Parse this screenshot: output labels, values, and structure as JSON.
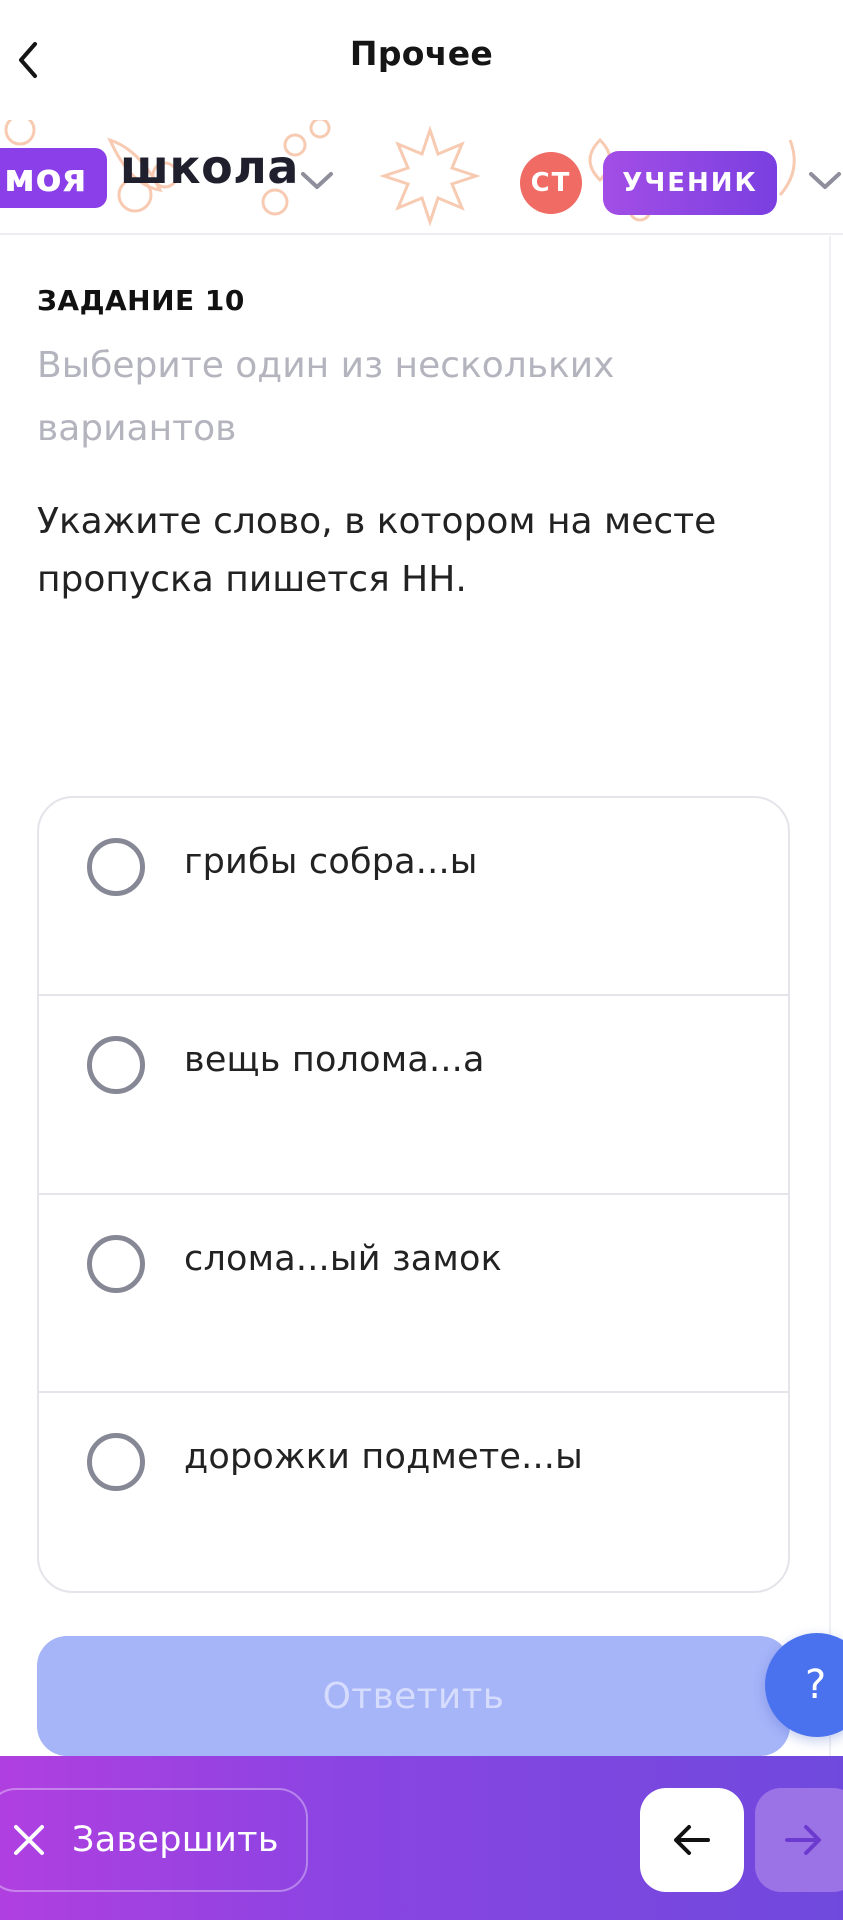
{
  "nav": {
    "title": "Прочее",
    "back_icon": "chevron-left-icon"
  },
  "brand": {
    "badge": "моя",
    "word": "школа",
    "accent_color": "#8a3fe8"
  },
  "user": {
    "initials": "СТ",
    "role": "УЧЕНИК",
    "avatar_color": "#ef6b64"
  },
  "task": {
    "label": "ЗАДАНИЕ 10",
    "instruction": "Выберите один из нескольких вариантов",
    "question": "Укажите слово, в котором на месте пропуска пишется НН.",
    "options": [
      "грибы собра...ы",
      "вещь полома...а",
      "слома...ый замок",
      "дорожки подмете...ы"
    ],
    "submit_label": "Ответить",
    "submit_color": "#a6b4f8"
  },
  "help": {
    "label": "?"
  },
  "footer": {
    "finish_label": "Завершить",
    "finish_icon": "close-icon",
    "prev_icon": "arrow-left-icon",
    "next_icon": "arrow-right-icon"
  }
}
